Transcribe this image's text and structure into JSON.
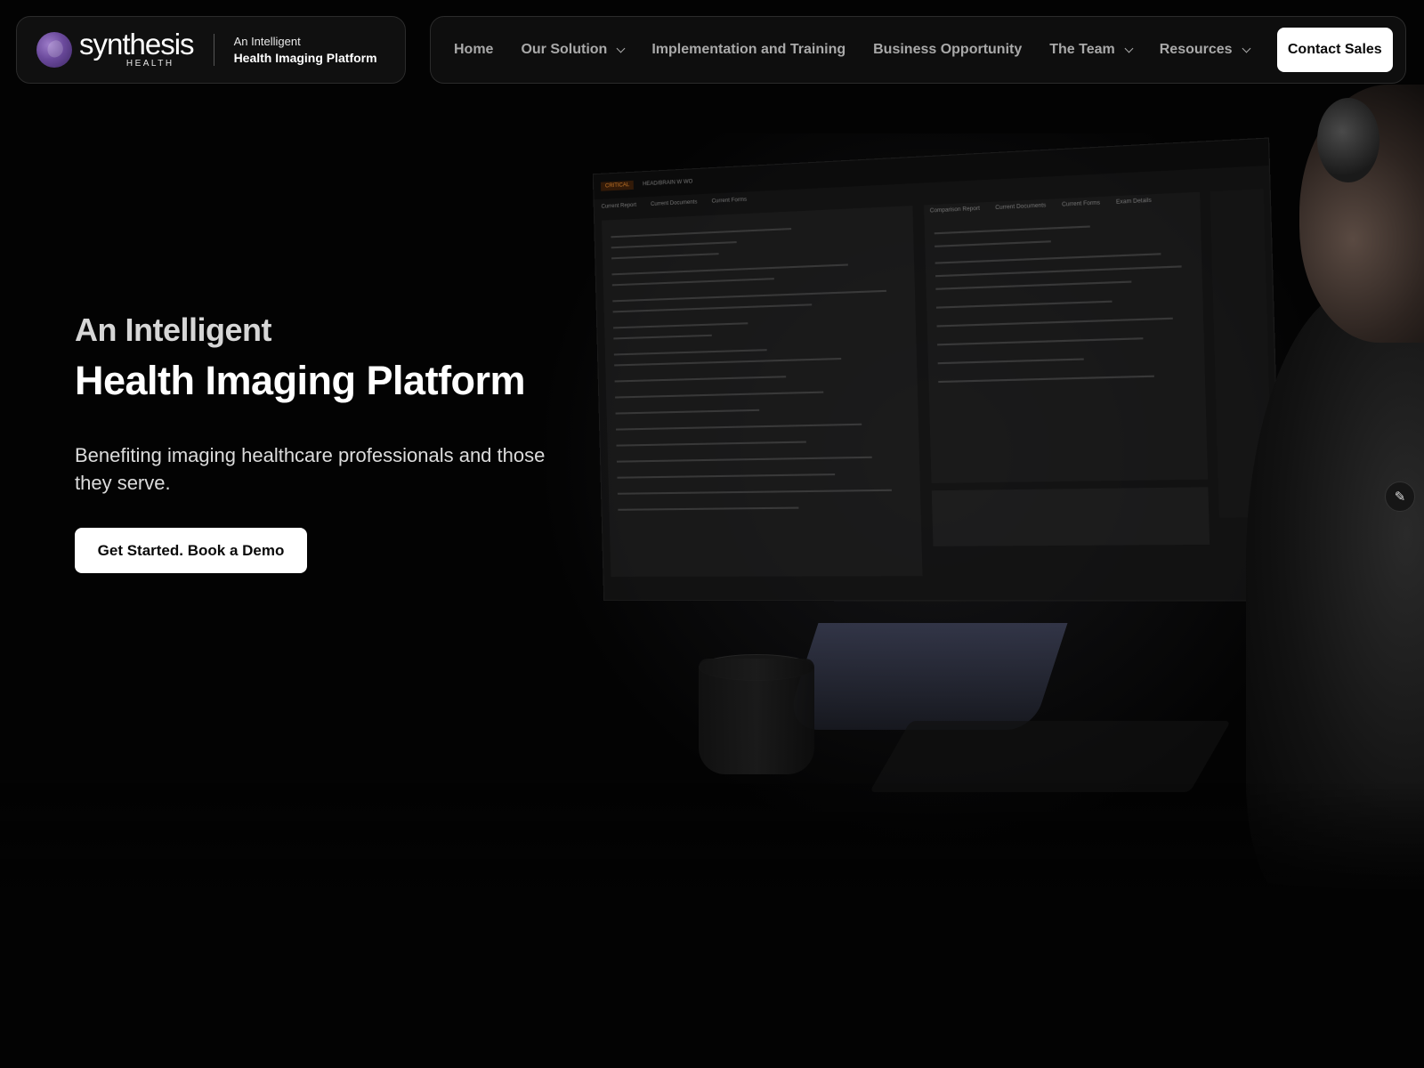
{
  "brand": {
    "logo_name": "synthesis",
    "logo_sub": "HEALTH",
    "tagline_line1": "An Intelligent",
    "tagline_line2": "Health Imaging Platform"
  },
  "nav": {
    "items": [
      {
        "label": "Home",
        "dropdown": false
      },
      {
        "label": "Our Solution",
        "dropdown": true
      },
      {
        "label": "Implementation and Training",
        "dropdown": false
      },
      {
        "label": "Business Opportunity",
        "dropdown": false
      },
      {
        "label": "The Team",
        "dropdown": true
      },
      {
        "label": "Resources",
        "dropdown": true
      }
    ],
    "cta_label": "Contact Sales"
  },
  "hero": {
    "eyebrow": "An Intelligent",
    "title": "Health Imaging Platform",
    "subtitle": "Benefiting imaging healthcare professionals and those they serve.",
    "cta_label": "Get Started. Book a Demo"
  },
  "monitor": {
    "critical_label": "CRITICAL",
    "study": "HEAD/BRAIN W WO",
    "tabs": [
      "Current Report",
      "Current Documents",
      "Current Forms"
    ],
    "right_tabs": [
      "Comparison Report",
      "Current Documents",
      "Current Forms",
      "Exam Details"
    ]
  },
  "icons": {
    "edit": "pencil-icon",
    "dropdown": "chevron-down-icon"
  },
  "colors": {
    "background": "#030303",
    "card": "#101010",
    "logo_purple": "#6b4a9c",
    "critical_orange": "#e58a2e"
  }
}
